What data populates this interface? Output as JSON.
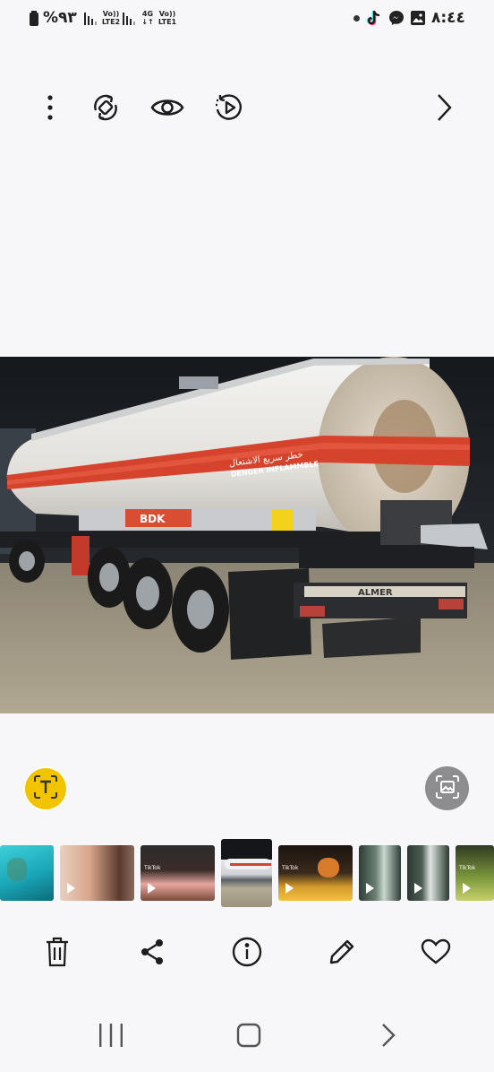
{
  "status_bar": {
    "time": "٨:٤٤",
    "battery": "%٩٣",
    "sim1_top": "Vo))",
    "sim1_bottom": "LTE2",
    "net_top": "4G",
    "net_bottom": "↓↑",
    "sim2_top": "Vo))",
    "sim2_bottom": "LTE1",
    "notification_icons": [
      "dot-icon",
      "tiktok-icon",
      "messenger-icon",
      "gallery-icon"
    ]
  },
  "top_toolbar": {
    "icons": [
      "more-options-icon",
      "auto-rotate-icon",
      "eye-icon",
      "play-remaster-icon",
      "chevron-right-icon"
    ]
  },
  "photo": {
    "tank_text_ar": "خطر سريع الاشتعال",
    "tank_text_en": "DENGER INFLAMMBLE",
    "brand_plate": "BDK",
    "rear_label": "ALMER"
  },
  "overlay_buttons": {
    "left_icon": "extract-text-icon",
    "right_icon": "image-search-icon"
  },
  "filmstrip": {
    "thumbnails": [
      {
        "video": false,
        "colors": [
          "#1aa6b7",
          "#3ed0d9",
          "#0d6b7a"
        ]
      },
      {
        "video": true,
        "colors": [
          "#d9a58c",
          "#5a3a2e",
          "#e8d0c0"
        ]
      },
      {
        "video": true,
        "colors": [
          "#2c2c2c",
          "#e8a7a0",
          "#7a4b3a"
        ],
        "label": "TikTok"
      },
      {
        "video": false,
        "colors": [
          "#cfd2d6",
          "#5a5f66",
          "#e7e9ec"
        ],
        "current": true
      },
      {
        "video": true,
        "colors": [
          "#1a1410",
          "#d49a2a",
          "#f1c340"
        ],
        "label": "TikTok"
      },
      {
        "video": true,
        "colors": [
          "#6b7f74",
          "#c9d6cf",
          "#2d3d35"
        ]
      },
      {
        "video": true,
        "colors": [
          "#4c5c54",
          "#e0e6e2",
          "#2a3a31"
        ]
      },
      {
        "video": true,
        "colors": [
          "#2f3b22",
          "#7e9a3d",
          "#c9d06b"
        ],
        "label": "TikTok"
      }
    ]
  },
  "bottom_toolbar": {
    "icons": [
      "delete-icon",
      "share-icon",
      "info-icon",
      "edit-icon",
      "favorite-icon"
    ]
  },
  "nav_bar": {
    "icons": [
      "recents-icon",
      "home-icon",
      "back-icon"
    ]
  },
  "colors": {
    "accent_yellow": "#f2c400",
    "stripe_red": "#d6432c",
    "icon_dark": "#1c1c1c"
  }
}
